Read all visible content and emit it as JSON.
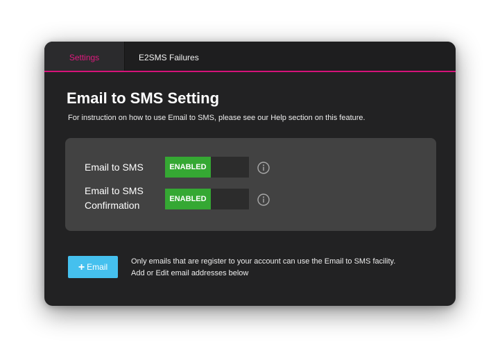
{
  "tabs": [
    {
      "label": "Settings",
      "active": true
    },
    {
      "label": "E2SMS Failures",
      "active": false
    }
  ],
  "header": {
    "title": "Email to SMS Setting",
    "subtitle": "For instruction on how to use Email to SMS, please see our Help section on this feature."
  },
  "settings": [
    {
      "label": "Email to SMS",
      "state": "ENABLED",
      "info_icon": "info-circle-icon"
    },
    {
      "label_line1": "Email to SMS",
      "label_line2": "Confirmation",
      "state": "ENABLED",
      "info_icon": "info-circle-icon"
    }
  ],
  "email_section": {
    "button_label": "Email",
    "button_icon": "plus-icon",
    "note_line1": "Only emails that are register to your account can use the Email to SMS facility.",
    "note_line2": "Add or Edit email addresses below"
  },
  "colors": {
    "accent": "#d6137a",
    "enabled": "#35a833",
    "button": "#45c0ee",
    "background": "#222223",
    "panel": "#424242"
  }
}
